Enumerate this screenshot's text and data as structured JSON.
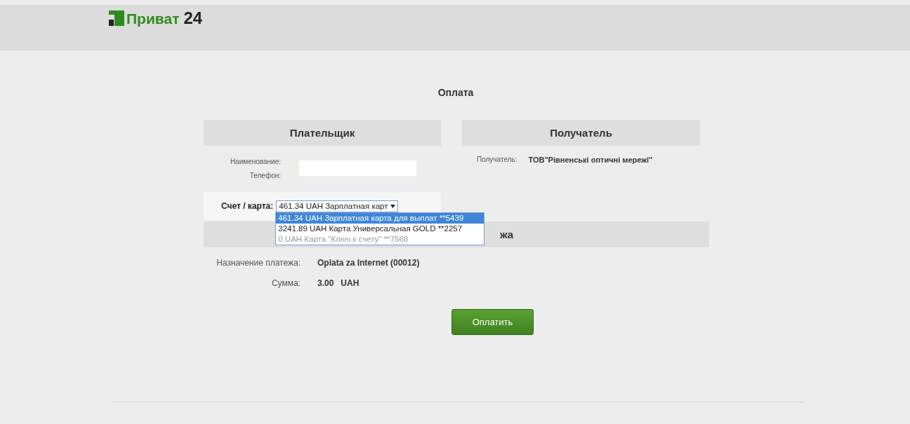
{
  "logo": {
    "word": "Приват",
    "number": "24"
  },
  "page_title": "Оплата",
  "payer": {
    "heading": "Плательщик",
    "name_label": "Наименование:",
    "phone_label": "Телефон:",
    "account_label": "Счет / карта:",
    "account_value": "461.34 UAH Зарплатная карт",
    "expanded": true,
    "options": [
      {
        "label": "461.34 UAH Зарплатная карта для выплат **5439",
        "selected": true,
        "disabled": false
      },
      {
        "label": "3241.89 UAH Карта Универсальная GOLD **2257",
        "selected": false,
        "disabled": false
      },
      {
        "label": "0 UAH Карта \"Ключ к счету\" **7568",
        "selected": false,
        "disabled": true
      }
    ]
  },
  "recipient": {
    "heading": "Получатель",
    "label": "Получатель:",
    "value": "ТОВ\"Рівненські оптичні мережі\""
  },
  "details": {
    "heading_visible": "жа",
    "purpose_label": "Назначение платежа:",
    "purpose_value": "Oplata za Internet (00012)",
    "amount_label": "Сумма:",
    "amount_value": "3.00",
    "currency": "UAH"
  },
  "pay_button": "Оплатить"
}
